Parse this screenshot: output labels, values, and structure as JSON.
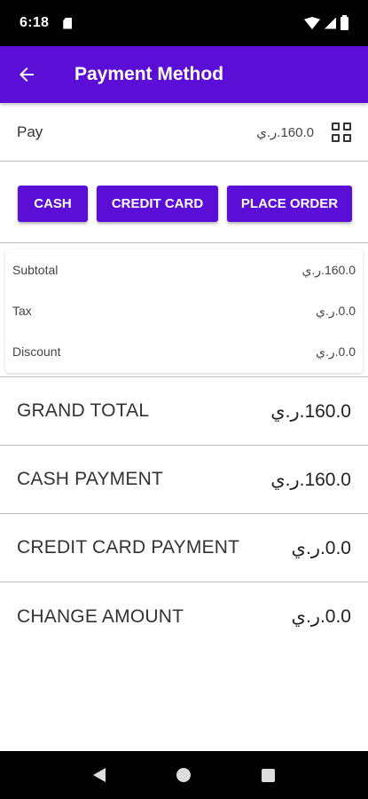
{
  "status_bar": {
    "time": "6:18"
  },
  "app_bar": {
    "title": "Payment Method"
  },
  "pay": {
    "label": "Pay",
    "amount": "160.0.ر.ي"
  },
  "buttons": {
    "cash": "CASH",
    "credit_card": "CREDIT CARD",
    "place_order": "PLACE ORDER"
  },
  "summary": {
    "subtotal": {
      "label": "Subtotal",
      "value": "160.0.ر.ي"
    },
    "tax": {
      "label": "Tax",
      "value": "0.0.ر.ي"
    },
    "discount": {
      "label": "Discount",
      "value": "0.0.ر.ي"
    }
  },
  "totals": {
    "grand_total": {
      "label": "GRAND TOTAL",
      "value": "160.0.ر.ي"
    },
    "cash_payment": {
      "label": "CASH PAYMENT",
      "value": "160.0.ر.ي"
    },
    "credit_card_payment": {
      "label": "CREDIT CARD PAYMENT",
      "value": "0.0.ر.ي"
    },
    "change_amount": {
      "label": "CHANGE AMOUNT",
      "value": "0.0.ر.ي"
    }
  },
  "colors": {
    "primary": "#5a0ed6",
    "status_bar": "#000000"
  },
  "icons": {
    "back": "arrow-back-icon",
    "grid": "grid-view-icon"
  }
}
